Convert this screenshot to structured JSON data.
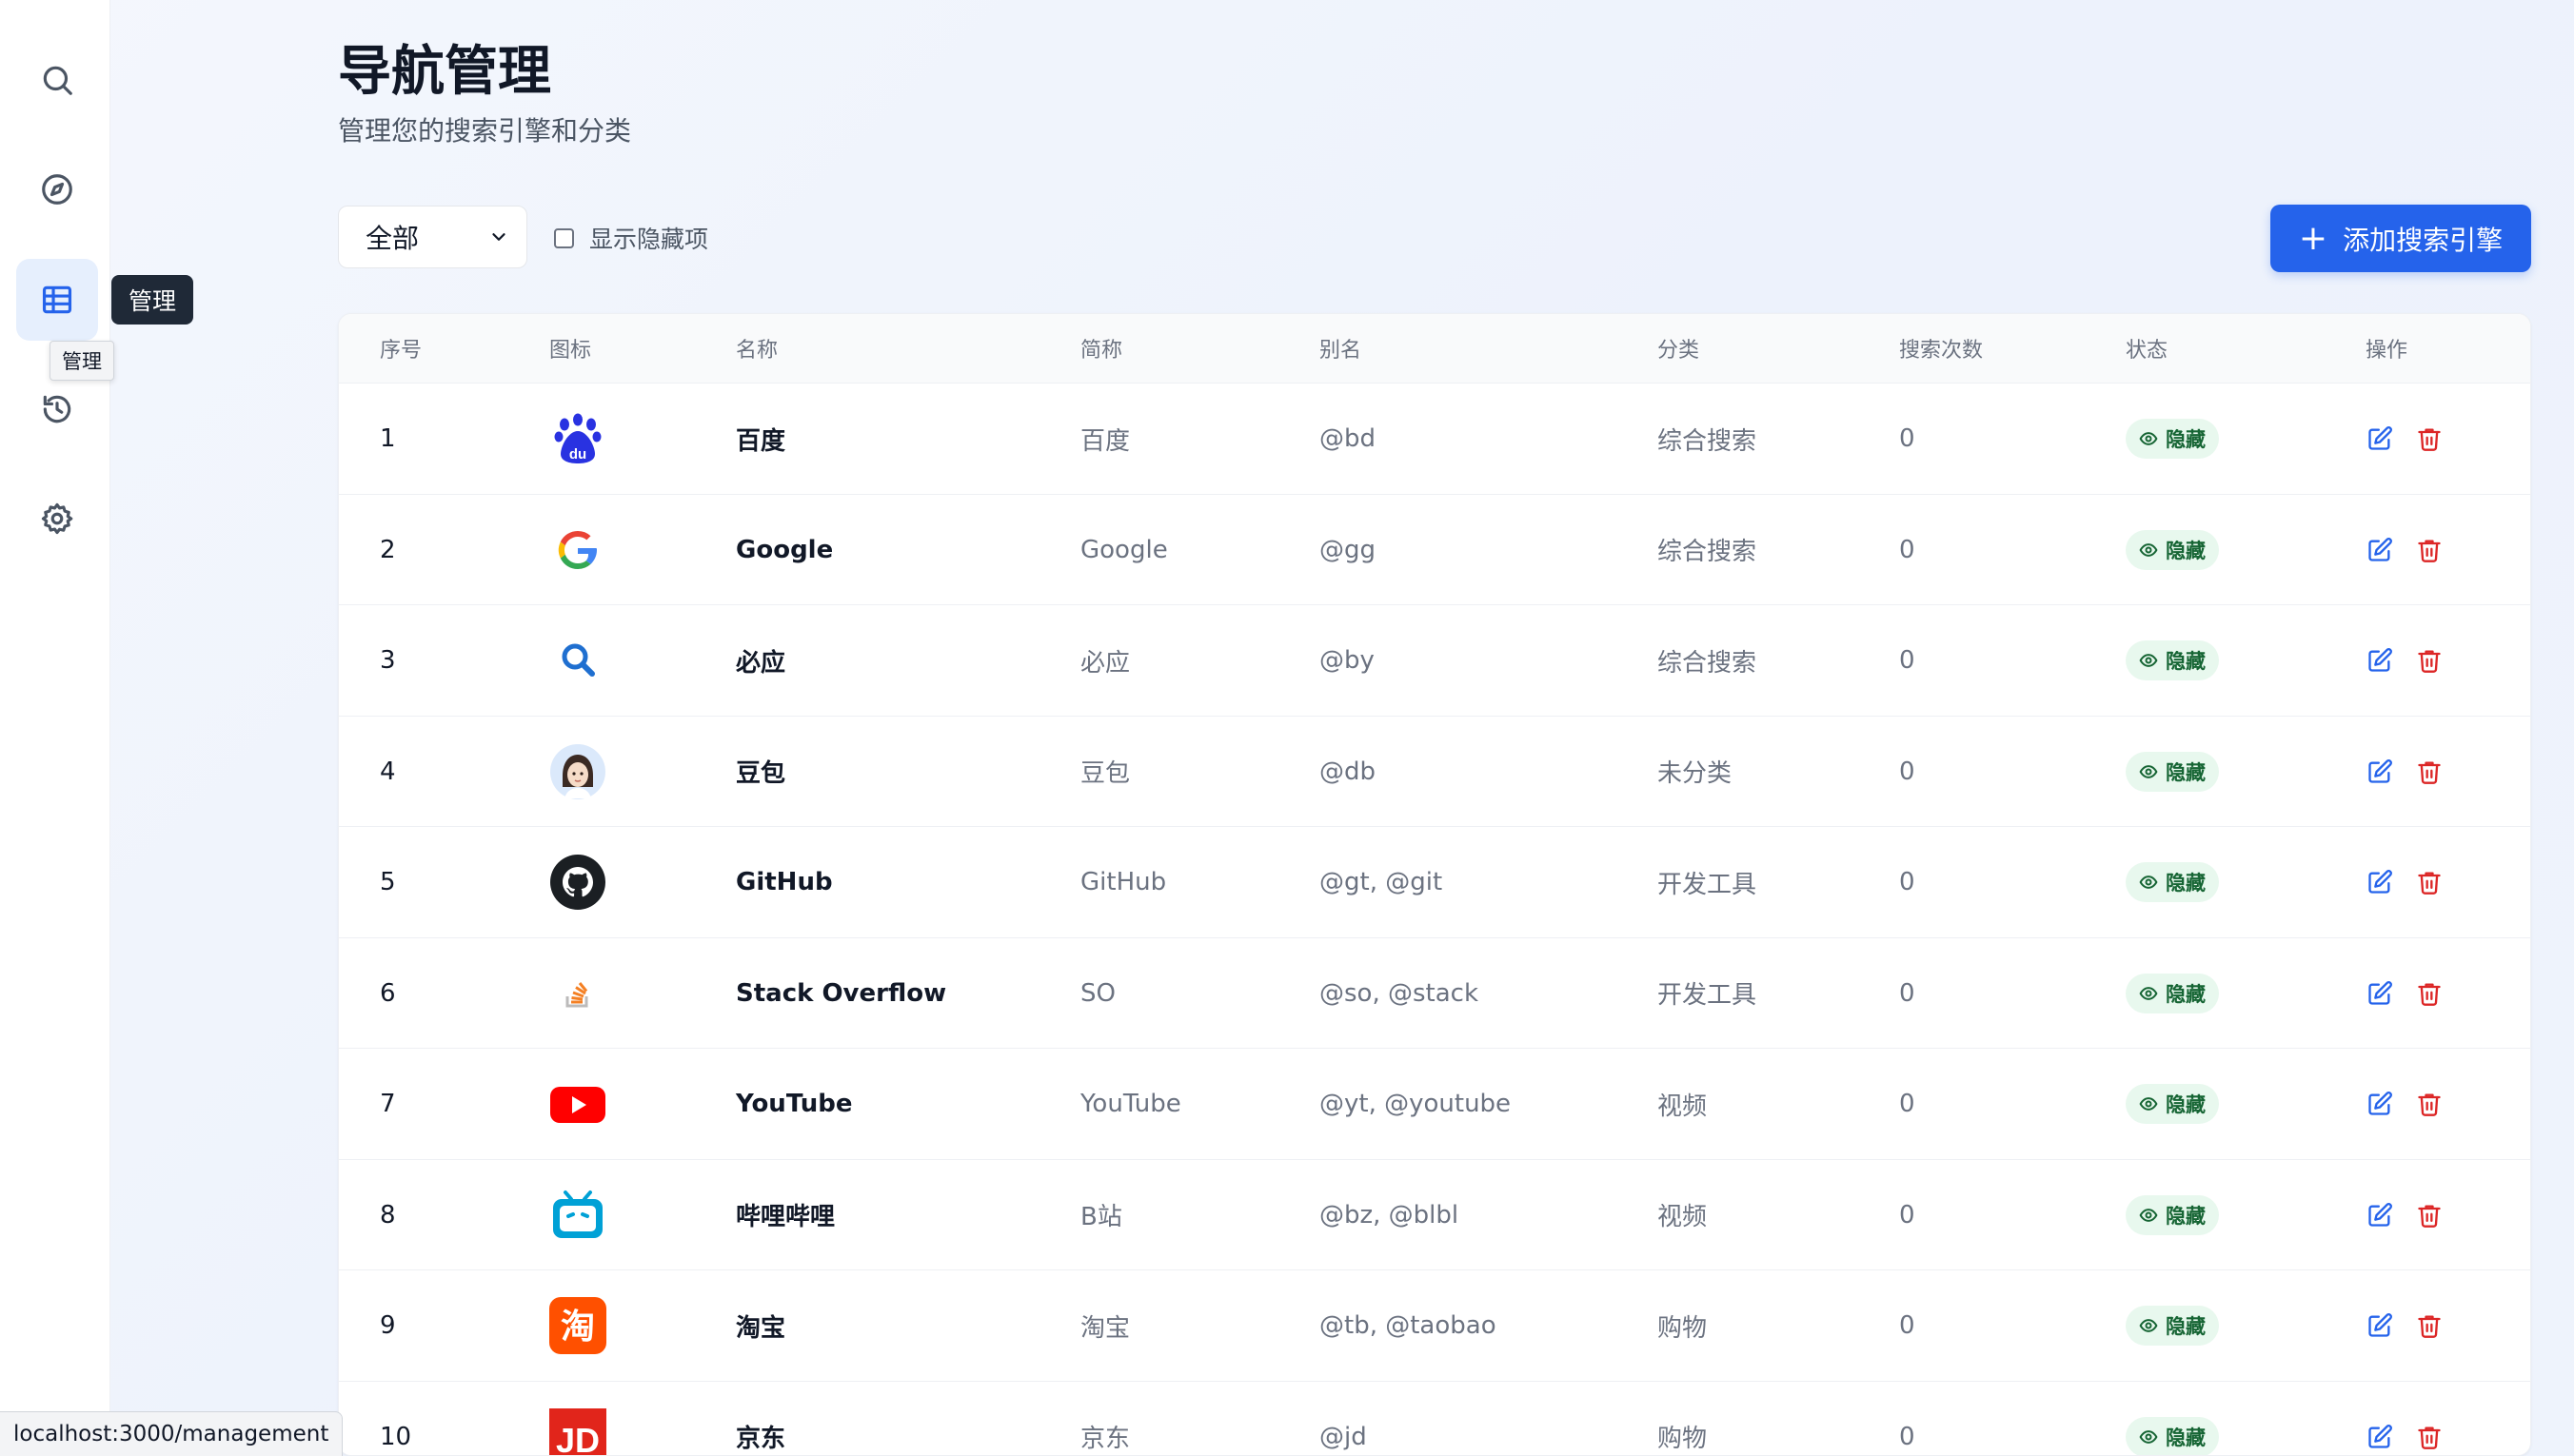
{
  "sidebar": {
    "tooltip": "管理",
    "hover_tooltip": "管理"
  },
  "header": {
    "title": "导航管理",
    "subtitle": "管理您的搜索引擎和分类"
  },
  "filter": {
    "selected": "全部",
    "show_hidden_label": "显示隐藏项",
    "show_hidden_checked": false
  },
  "add_button": {
    "label": "添加搜索引擎"
  },
  "table": {
    "columns": [
      "序号",
      "图标",
      "名称",
      "简称",
      "别名",
      "分类",
      "搜索次数",
      "状态",
      "操作"
    ],
    "rows": [
      {
        "index": "1",
        "icon": "baidu-icon",
        "name": "百度",
        "short": "百度",
        "alias": "@bd",
        "category": "综合搜索",
        "count": "0",
        "status": "隐藏"
      },
      {
        "index": "2",
        "icon": "google-icon",
        "name": "Google",
        "short": "Google",
        "alias": "@gg",
        "category": "综合搜索",
        "count": "0",
        "status": "隐藏"
      },
      {
        "index": "3",
        "icon": "bing-search-icon",
        "name": "必应",
        "short": "必应",
        "alias": "@by",
        "category": "综合搜索",
        "count": "0",
        "status": "隐藏"
      },
      {
        "index": "4",
        "icon": "doubao-avatar-icon",
        "name": "豆包",
        "short": "豆包",
        "alias": "@db",
        "category": "未分类",
        "count": "0",
        "status": "隐藏"
      },
      {
        "index": "5",
        "icon": "github-icon",
        "name": "GitHub",
        "short": "GitHub",
        "alias": "@gt, @git",
        "category": "开发工具",
        "count": "0",
        "status": "隐藏"
      },
      {
        "index": "6",
        "icon": "stackoverflow-icon",
        "name": "Stack Overflow",
        "short": "SO",
        "alias": "@so, @stack",
        "category": "开发工具",
        "count": "0",
        "status": "隐藏"
      },
      {
        "index": "7",
        "icon": "youtube-icon",
        "name": "YouTube",
        "short": "YouTube",
        "alias": "@yt, @youtube",
        "category": "视频",
        "count": "0",
        "status": "隐藏"
      },
      {
        "index": "8",
        "icon": "bilibili-icon",
        "name": "哔哩哔哩",
        "short": "B站",
        "alias": "@bz, @blbl",
        "category": "视频",
        "count": "0",
        "status": "隐藏"
      },
      {
        "index": "9",
        "icon": "taobao-icon",
        "name": "淘宝",
        "short": "淘宝",
        "alias": "@tb, @taobao",
        "category": "购物",
        "count": "0",
        "status": "隐藏"
      },
      {
        "index": "10",
        "icon": "jd-icon",
        "name": "京东",
        "short": "京东",
        "alias": "@jd",
        "category": "购物",
        "count": "0",
        "status": "隐藏"
      }
    ]
  },
  "icon_text": {
    "baidu": "du",
    "taobao": "淘",
    "jd": "JD"
  },
  "statusbar": {
    "url": "localhost:3000/management"
  },
  "colors": {
    "accent": "#2563eb",
    "badge_bg": "#e8f8ee",
    "badge_text": "#166534",
    "delete": "#dc2626",
    "edit": "#2563eb"
  }
}
